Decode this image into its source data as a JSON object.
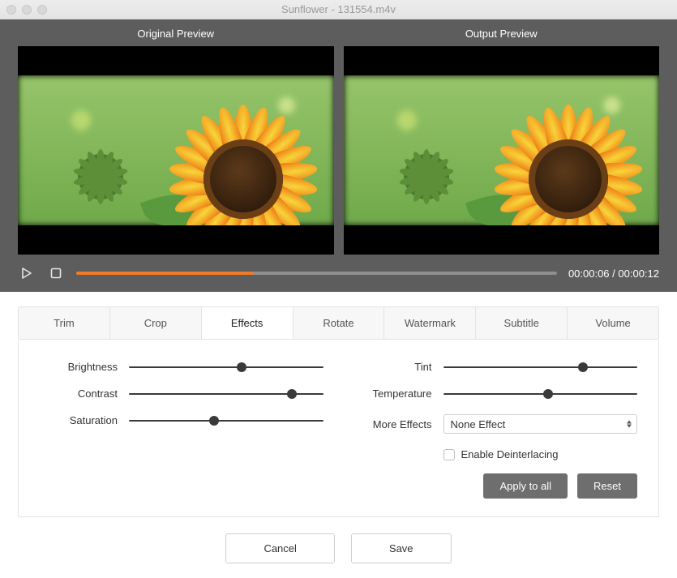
{
  "window": {
    "title": "Sunflower - 131554.m4v"
  },
  "preview": {
    "original_label": "Original Preview",
    "output_label": "Output  Preview"
  },
  "transport": {
    "current": "00:00:06",
    "total": "00:00:12",
    "progress_pct": 37
  },
  "tabs": {
    "items": [
      {
        "label": "Trim"
      },
      {
        "label": "Crop"
      },
      {
        "label": "Effects",
        "active": true
      },
      {
        "label": "Rotate"
      },
      {
        "label": "Watermark"
      },
      {
        "label": "Subtitle"
      },
      {
        "label": "Volume"
      }
    ]
  },
  "effects": {
    "brightness": {
      "label": "Brightness",
      "pct": 58
    },
    "contrast": {
      "label": "Contrast",
      "pct": 84
    },
    "saturation": {
      "label": "Saturation",
      "pct": 44
    },
    "tint": {
      "label": "Tint",
      "pct": 72
    },
    "temperature": {
      "label": "Temperature",
      "pct": 54
    },
    "more_effects_label": "More Effects",
    "more_effects_value": "None Effect",
    "deinterlace_label": "Enable Deinterlacing",
    "deinterlace_checked": false
  },
  "buttons": {
    "apply_all": "Apply to all",
    "reset": "Reset",
    "cancel": "Cancel",
    "save": "Save"
  }
}
